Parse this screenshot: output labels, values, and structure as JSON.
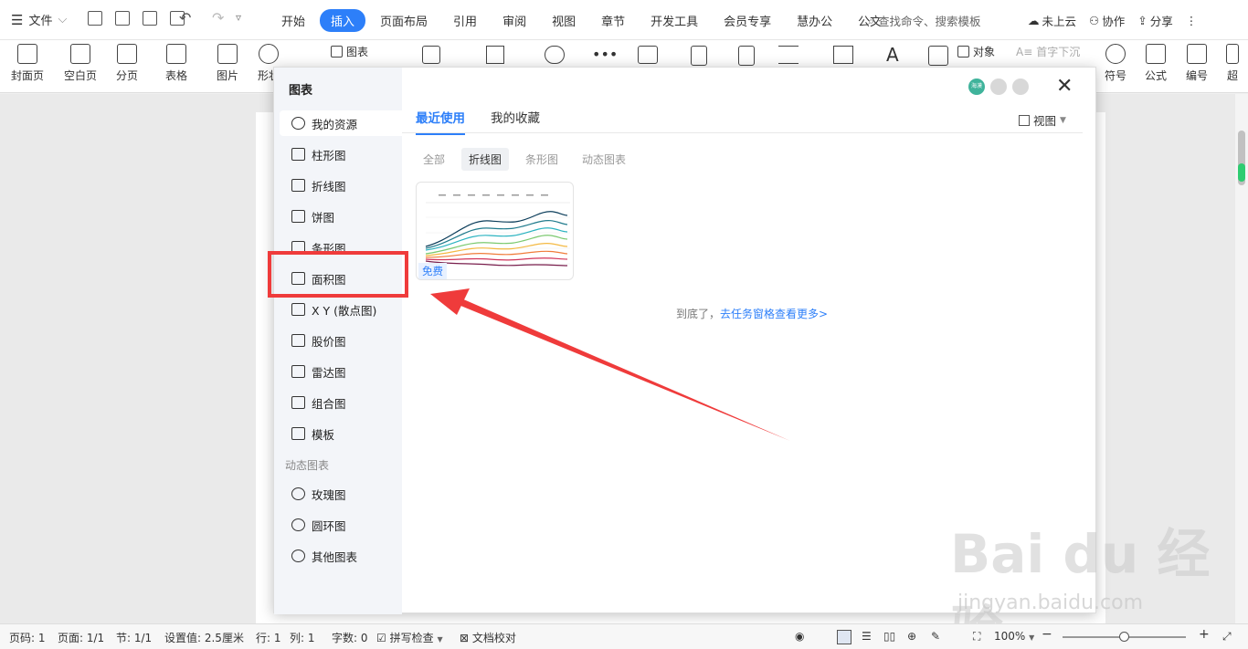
{
  "menubar": {
    "file_label": "文件",
    "tabs": [
      "开始",
      "插入",
      "页面布局",
      "引用",
      "审阅",
      "视图",
      "章节",
      "开发工具",
      "会员专享",
      "慧办公",
      "公文"
    ],
    "active_tab": "插入",
    "search_placeholder": "查找命令、搜索模板",
    "cloud": "未上云",
    "collab": "协作",
    "share": "分享"
  },
  "ribbon": {
    "buttons": [
      "封面页",
      "空白页",
      "分页",
      "表格",
      "图片",
      "形状",
      "符号",
      "公式",
      "编号",
      "超"
    ],
    "chart_label": "图表",
    "object_label": "对象",
    "dropcap_label": "首字下沉"
  },
  "dialog": {
    "title": "图表",
    "sidebar": {
      "items": [
        "我的资源",
        "柱形图",
        "折线图",
        "饼图",
        "条形图",
        "面积图",
        "X Y (散点图)",
        "股价图",
        "雷达图",
        "组合图",
        "模板"
      ],
      "dynamic_header": "动态图表",
      "dynamic_items": [
        "玫瑰图",
        "圆环图",
        "其他图表"
      ]
    },
    "tabs": [
      "最近使用",
      "我的收藏"
    ],
    "view_label": "视图",
    "filters": [
      "全部",
      "折线图",
      "条形图",
      "动态图表"
    ],
    "active_filter": "折线图",
    "card_badge": "免费",
    "end_text": "到底了，",
    "end_link": "去任务窗格查看更多>",
    "header_badge": "海漠"
  },
  "status": {
    "page_code": "页码: 1",
    "pages": "页面: 1/1",
    "section": "节: 1/1",
    "setting": "设置值: 2.5厘米",
    "row": "行: 1",
    "col": "列: 1",
    "words": "字数: 0",
    "spell": "拼写检查",
    "proof": "文档校对",
    "zoom": "100%"
  },
  "watermark": {
    "main": "Bai du 经验",
    "sub": "jingyan.baidu.com"
  }
}
